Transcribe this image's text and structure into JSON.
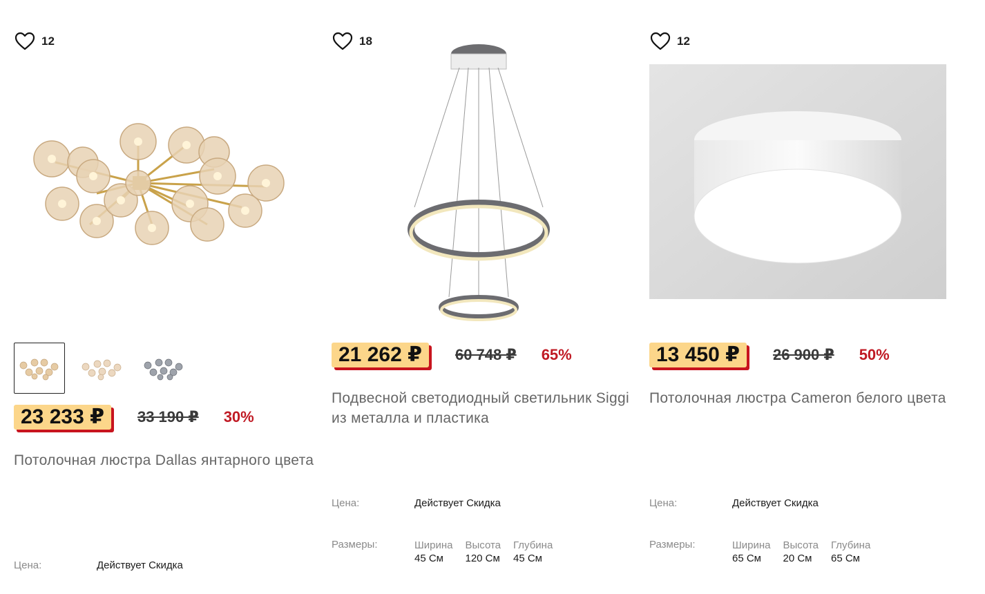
{
  "products": [
    {
      "favorites_count": "12",
      "price": "23 233 ₽",
      "old_price": "33 190 ₽",
      "discount": "30%",
      "title": "Потолочная люстра Dallas янтарного цвета",
      "price_label": "Цена:",
      "price_note": "Действует Скидка"
    },
    {
      "favorites_count": "18",
      "price": "21 262 ₽",
      "old_price": "60 748 ₽",
      "discount": "65%",
      "title": "Подвесной светодиодный светильник Siggi из металла и пластика",
      "price_label": "Цена:",
      "price_note": "Действует Скидка",
      "sizes_label": "Размеры:",
      "dimensions": [
        {
          "name": "Ширина",
          "value": "45 См"
        },
        {
          "name": "Высота",
          "value": "120 См"
        },
        {
          "name": "Глубина",
          "value": "45 См"
        }
      ]
    },
    {
      "favorites_count": "12",
      "price": "13 450 ₽",
      "old_price": "26 900 ₽",
      "discount": "50%",
      "title": "Потолочная люстра Cameron белого цвета",
      "price_label": "Цена:",
      "price_note": "Действует Скидка",
      "sizes_label": "Размеры:",
      "dimensions": [
        {
          "name": "Ширина",
          "value": "65 См"
        },
        {
          "name": "Высота",
          "value": "20 См"
        },
        {
          "name": "Глубина",
          "value": "65 См"
        }
      ]
    }
  ],
  "colors": {
    "price_highlight": "#fcd68a",
    "price_shadow": "#c8141e",
    "discount": "#c01a24"
  },
  "icons": {
    "favorite": "heart-outline-icon"
  }
}
